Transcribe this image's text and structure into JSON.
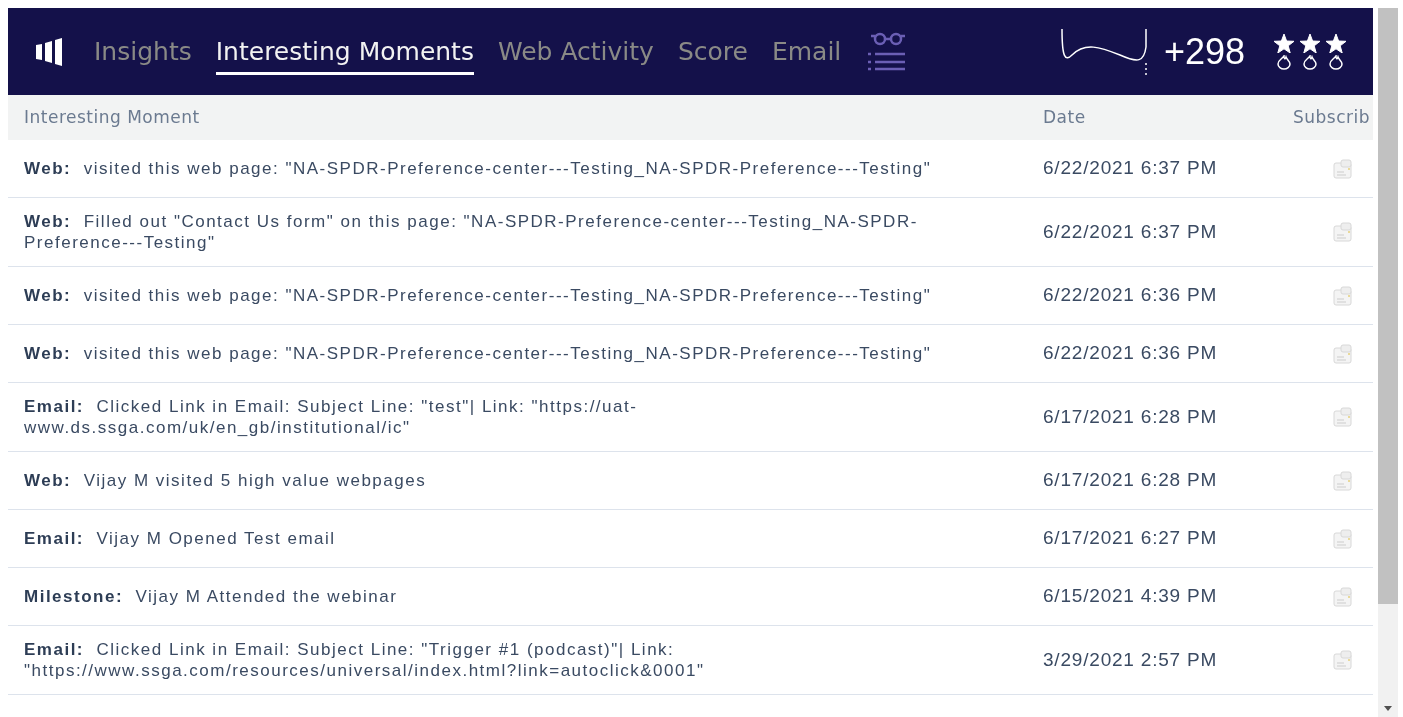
{
  "nav": {
    "tabs": [
      {
        "label": "Insights",
        "selected": false
      },
      {
        "label": "Interesting Moments",
        "selected": true
      },
      {
        "label": "Web Activity",
        "selected": false
      },
      {
        "label": "Score",
        "selected": false
      },
      {
        "label": "Email",
        "selected": false
      }
    ],
    "score": "+298",
    "stars": 3
  },
  "table": {
    "columns": [
      "Interesting Moment",
      "Date",
      "Subscrib"
    ],
    "rows": [
      {
        "moment": "**Web:**  visited this web page: \"NA-SPDR-Preference-center---Testing_NA-SPDR-Preference---Testing\"",
        "date": "6/22/2021 6:37 PM"
      },
      {
        "moment": "**Web:**  Filled out \"Contact Us form\" on this page: \"NA-SPDR-Preference-center---Testing_NA-SPDR-Preference---Testing\"",
        "date": "6/22/2021 6:37 PM"
      },
      {
        "moment": "**Web:**  visited this web page: \"NA-SPDR-Preference-center---Testing_NA-SPDR-Preference---Testing\"",
        "date": "6/22/2021 6:36 PM"
      },
      {
        "moment": "**Web:**  visited this web page: \"NA-SPDR-Preference-center---Testing_NA-SPDR-Preference---Testing\"",
        "date": "6/22/2021 6:36 PM"
      },
      {
        "moment": "**Email:**  Clicked Link in Email: Subject Line: \"test\"| Link: \"https://uat-www.ds.ssga.com/uk/en_gb/institutional/ic\"",
        "date": "6/17/2021 6:28 PM"
      },
      {
        "moment": "**Web:**  Vijay M visited 5 high value webpages",
        "date": "6/17/2021 6:28 PM"
      },
      {
        "moment": "**Email:**  Vijay M Opened Test email",
        "date": "6/17/2021 6:27 PM"
      },
      {
        "moment": "**Milestone:**  Vijay M Attended the webinar",
        "date": "6/15/2021 4:39 PM"
      },
      {
        "moment": "**Email:**  Clicked Link in Email: Subject Line: \"Trigger #1 (podcast)\"| Link: \"https://www.ssga.com/resources/universal/index.html?link=autoclick&0001\"",
        "date": "3/29/2021 2:57 PM"
      }
    ]
  }
}
